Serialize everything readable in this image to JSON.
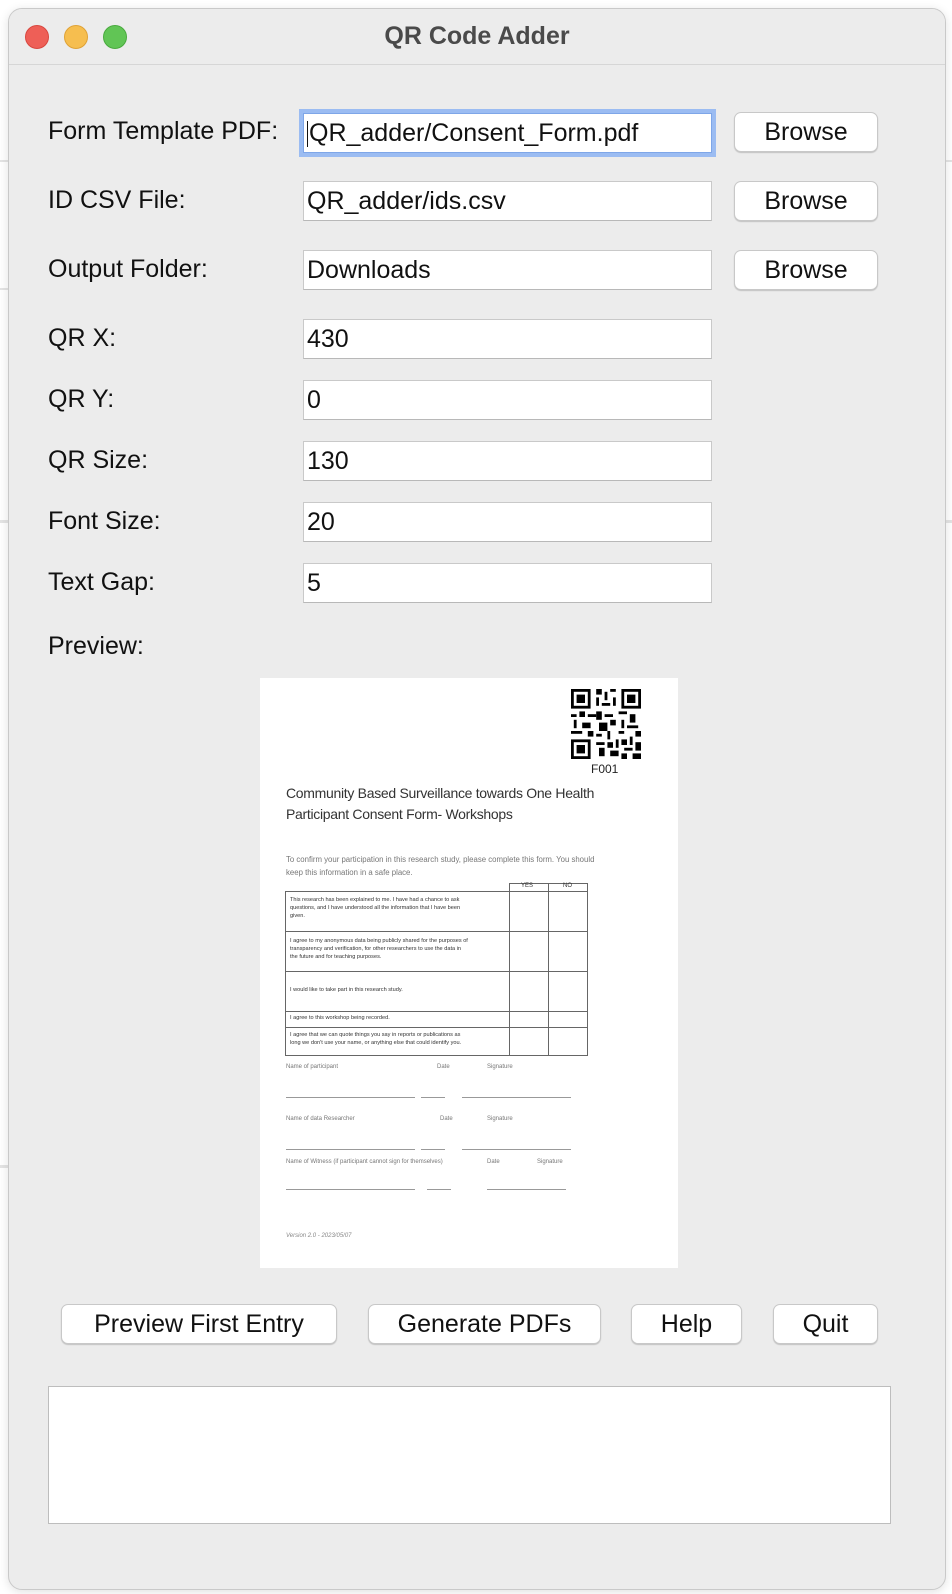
{
  "window": {
    "title": "QR Code Adder"
  },
  "form": {
    "template_pdf": {
      "label": "Form Template PDF:",
      "value": "QR_adder/Consent_Form.pdf",
      "browse": "Browse"
    },
    "id_csv": {
      "label": "ID CSV File:",
      "value": "QR_adder/ids.csv",
      "browse": "Browse"
    },
    "output_folder": {
      "label": "Output Folder:",
      "value": "Downloads",
      "browse": "Browse"
    },
    "qr_x": {
      "label": "QR X:",
      "value": "430"
    },
    "qr_y": {
      "label": "QR Y:",
      "value": "0"
    },
    "qr_size": {
      "label": "QR Size:",
      "value": "130"
    },
    "font_size": {
      "label": "Font Size:",
      "value": "20"
    },
    "text_gap": {
      "label": "Text Gap:",
      "value": "5"
    }
  },
  "preview": {
    "label": "Preview:",
    "id_text": "F001",
    "heading_line1": "Community Based Surveillance towards One Health",
    "heading_line2": "Participant Consent Form-  Workshops",
    "intro_line1": "To confirm your participation in this research study, please complete this form. You should",
    "intro_line2": "keep this information in a safe place.",
    "col_yes": "YES",
    "col_no": "NO",
    "statements": [
      [
        "This research has been explained to me. I have had a chance to ask",
        "questions, and I have understood all the information that I have been",
        "given."
      ],
      [
        "I agree to my anonymous data being publicly shared for the purposes of",
        "transparency and verification, for other researchers to use the data in",
        "the future and for teaching purposes."
      ],
      [
        "I would like to take part in this research study."
      ],
      [
        "I agree to this workshop being recorded."
      ],
      [
        "I agree that we can quote things you say in reports or publications as",
        "long we don't use your name, or anything else that could identify you."
      ]
    ],
    "sig_participant": {
      "name": "Name of participant",
      "date": "Date",
      "signature": "Signature"
    },
    "sig_researcher": {
      "name": "Name of data Researcher",
      "date": "Date",
      "signature": "Signature"
    },
    "sig_witness": {
      "name": "Name of Witness (if participant cannot sign for themselves)",
      "date": "Date",
      "signature": "Signature"
    },
    "version": "Version 2.0 - 2023/05/07"
  },
  "actions": {
    "preview_first": "Preview First Entry",
    "generate": "Generate PDFs",
    "help": "Help",
    "quit": "Quit"
  },
  "log": {
    "text": ""
  }
}
